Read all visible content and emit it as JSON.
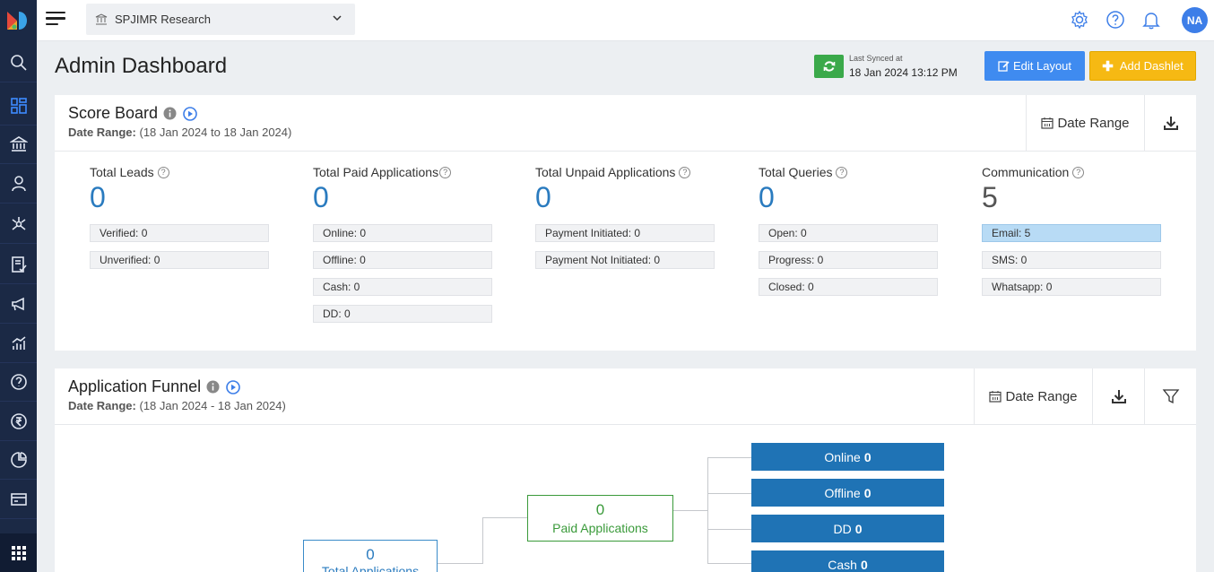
{
  "topbar": {
    "institute": "SPJIMR Research",
    "avatar_initials": "NA"
  },
  "page": {
    "title": "Admin Dashboard",
    "last_synced_label": "Last Synced at",
    "last_synced_time": "18 Jan 2024 13:12 PM",
    "edit_layout_label": "Edit Layout",
    "add_dashlet_label": "Add Dashlet"
  },
  "scoreboard": {
    "title": "Score Board",
    "date_range_label": "Date Range:",
    "date_range_value": "(18 Jan 2024 to 18 Jan 2024)",
    "date_range_button": "Date Range",
    "metrics": [
      {
        "label": "Total Leads",
        "value": "0",
        "items": [
          "Verified: 0",
          "Unverified: 0"
        ]
      },
      {
        "label": "Total Paid Applications",
        "value": "0",
        "items": [
          "Online: 0",
          "Offline: 0",
          "Cash: 0",
          "DD: 0"
        ]
      },
      {
        "label": "Total Unpaid Applications",
        "value": "0",
        "items": [
          "Payment Initiated: 0",
          "Payment Not Initiated: 0"
        ]
      },
      {
        "label": "Total Queries",
        "value": "0",
        "items": [
          "Open: 0",
          "Progress: 0",
          "Closed: 0"
        ]
      },
      {
        "label": "Communication",
        "value": "5",
        "items": [
          "Email: 5",
          "SMS: 0",
          "Whatsapp: 0"
        ]
      }
    ]
  },
  "funnel": {
    "title": "Application Funnel",
    "date_range_label": "Date Range:",
    "date_range_value": "(18 Jan 2024 - 18 Jan 2024)",
    "date_range_button": "Date Range",
    "total_applications": {
      "value": "0",
      "label": "Total Applications"
    },
    "paid_applications": {
      "value": "0",
      "label": "Paid Applications"
    },
    "leaves": [
      {
        "label": "Online",
        "value": "0"
      },
      {
        "label": "Offline",
        "value": "0"
      },
      {
        "label": "DD",
        "value": "0"
      },
      {
        "label": "Cash",
        "value": "0"
      }
    ]
  },
  "colors": {
    "sidebar": "#1b2945",
    "accent_blue": "#2a7bbf",
    "edit_button": "#3f8bf0",
    "add_button": "#f6b913",
    "sync_button": "#3aa94a",
    "funnel_leaf": "#1f73b5"
  }
}
